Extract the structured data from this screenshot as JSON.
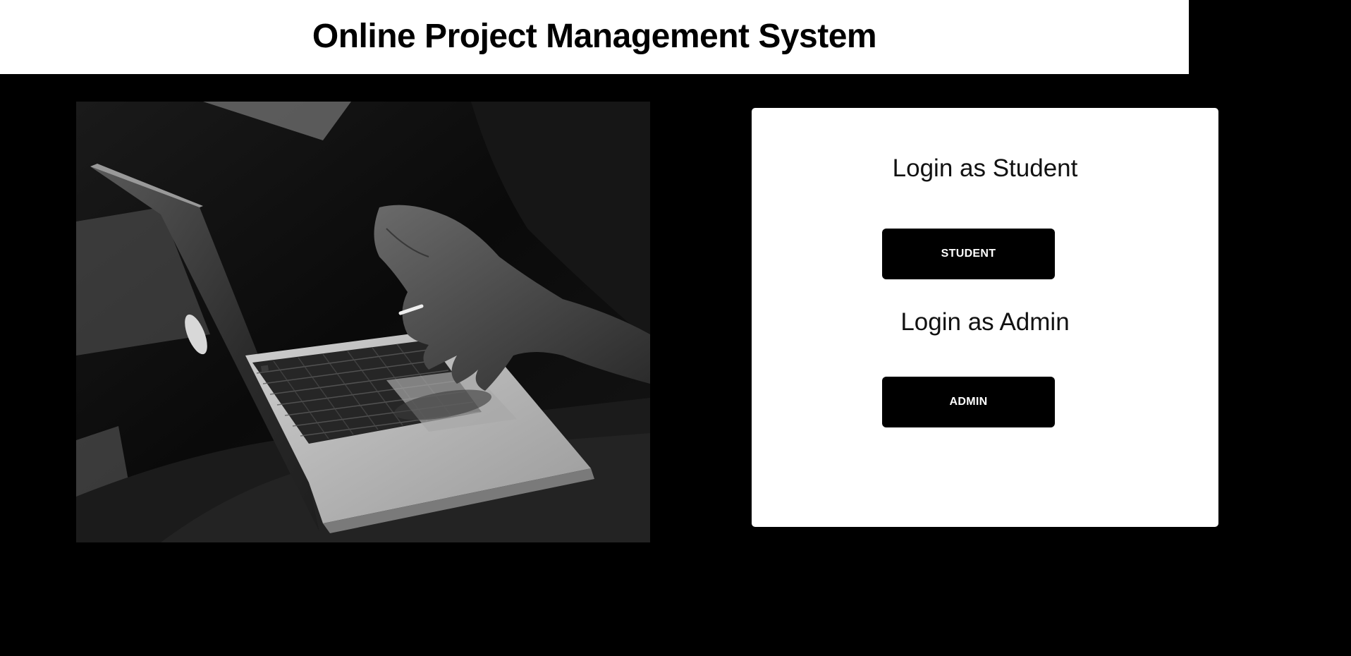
{
  "header": {
    "title": "Online Project Management System"
  },
  "hero": {
    "icon": "laptop-photo",
    "colors": {
      "background": "#0b0b0b",
      "laptop": "#b9b9b9",
      "keys": "#1d1d1d"
    }
  },
  "login_card": {
    "student": {
      "heading": "Login as Student",
      "button_label": "STUDENT"
    },
    "admin": {
      "heading": "Login as Admin",
      "button_label": "ADMIN"
    }
  },
  "colors": {
    "page_background": "#000000",
    "header_background": "#ffffff",
    "card_background": "#ffffff",
    "button_background": "#000000",
    "button_text": "#ffffff"
  }
}
